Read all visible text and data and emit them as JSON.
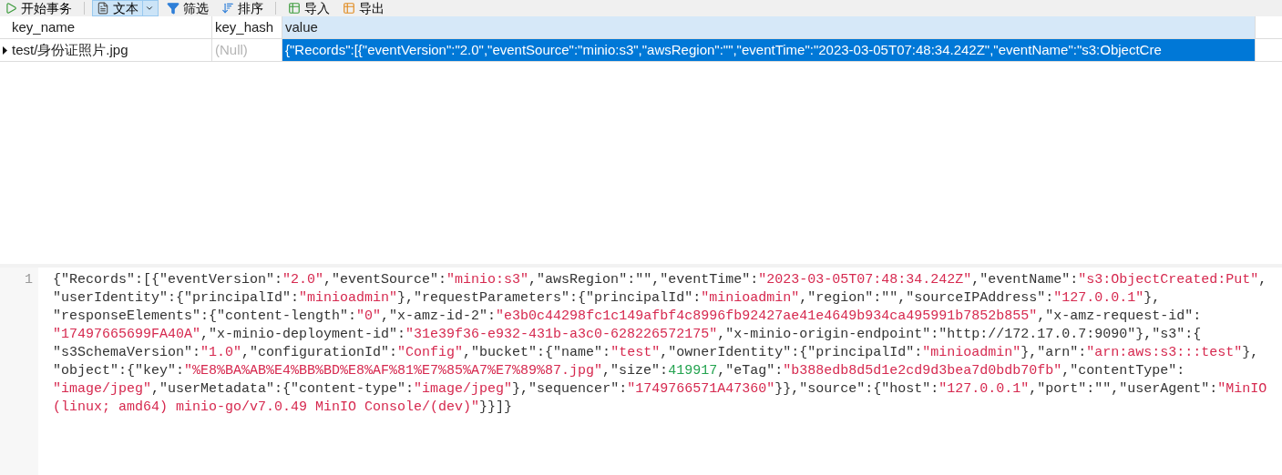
{
  "toolbar": [
    {
      "kind": "transaction",
      "label": "开始事务",
      "selected": false,
      "dropdown": false
    },
    {
      "kind": "text",
      "label": "文本",
      "selected": true,
      "dropdown": true
    },
    {
      "kind": "filter",
      "label": "筛选",
      "selected": false,
      "dropdown": false
    },
    {
      "kind": "sort",
      "label": "排序",
      "selected": false,
      "dropdown": false
    },
    {
      "kind": "import",
      "label": "导入",
      "selected": false,
      "dropdown": false
    },
    {
      "kind": "export",
      "label": "导出",
      "selected": false,
      "dropdown": false
    }
  ],
  "grid": {
    "columns": [
      "key_name",
      "key_hash",
      "value"
    ],
    "rows": [
      {
        "current": true,
        "cells": [
          {
            "kind": "text",
            "text": "test/身份证照片.jpg",
            "selected": false
          },
          {
            "kind": "null",
            "text": "(Null)",
            "selected": false
          },
          {
            "kind": "text",
            "text": "{\"Records\":[{\"eventVersion\":\"2.0\",\"eventSource\":\"minio:s3\",\"awsRegion\":\"\",\"eventTime\":\"2023-03-05T07:48:34.242Z\",\"eventName\":\"s3:ObjectCre",
            "selected": true
          }
        ]
      }
    ]
  },
  "editor": {
    "line_number": "1",
    "rows": [
      {
        "segments": [
          {
            "kind": "plain",
            "text": "{\"Records\":[{\"eventVersion\":"
          },
          {
            "kind": "string",
            "text": "\"2.0\""
          },
          {
            "kind": "plain",
            "text": ",\"eventSource\":"
          },
          {
            "kind": "string",
            "text": "\"minio:s3\""
          },
          {
            "kind": "plain",
            "text": ",\"awsRegion\":\"\",\"eventTime\":"
          },
          {
            "kind": "string",
            "text": "\"2023-03-05T07:48:34.242Z\""
          },
          {
            "kind": "plain",
            "text": ",\"eventName\":"
          },
          {
            "kind": "string",
            "text": "\"s3:ObjectCreated:Put\""
          },
          {
            "kind": "plain",
            "text": ","
          }
        ]
      },
      {
        "segments": [
          {
            "kind": "plain",
            "text": "\"userIdentity\":{\"principalId\":"
          },
          {
            "kind": "string",
            "text": "\"minioadmin\""
          },
          {
            "kind": "plain",
            "text": "},\"requestParameters\":{\"principalId\":"
          },
          {
            "kind": "string",
            "text": "\"minioadmin\""
          },
          {
            "kind": "plain",
            "text": ",\"region\":\"\",\"sourceIPAddress\":"
          },
          {
            "kind": "string",
            "text": "\"127.0.0.1\""
          },
          {
            "kind": "plain",
            "text": "},"
          }
        ]
      },
      {
        "segments": [
          {
            "kind": "plain",
            "text": "\"responseElements\":{\"content-length\":"
          },
          {
            "kind": "string",
            "text": "\"0\""
          },
          {
            "kind": "plain",
            "text": ",\"x-amz-id-2\":"
          },
          {
            "kind": "string",
            "text": "\"e3b0c44298fc1c149afbf4c8996fb92427ae41e4649b934ca495991b7852b855\""
          },
          {
            "kind": "plain",
            "text": ",\"x-amz-request-id\":"
          }
        ]
      },
      {
        "segments": [
          {
            "kind": "string",
            "text": "\"17497665699FA40A\""
          },
          {
            "kind": "plain",
            "text": ",\"x-minio-deployment-id\":"
          },
          {
            "kind": "string",
            "text": "\"31e39f36-e932-431b-a3c0-628226572175\""
          },
          {
            "kind": "plain",
            "text": ",\"x-minio-origin-endpoint\":\"http://172.17.0.7:9090\"},\"s3\":{"
          }
        ]
      },
      {
        "segments": [
          {
            "kind": "plain",
            "text": "\"s3SchemaVersion\":"
          },
          {
            "kind": "string",
            "text": "\"1.0\""
          },
          {
            "kind": "plain",
            "text": ",\"configurationId\":"
          },
          {
            "kind": "string",
            "text": "\"Config\""
          },
          {
            "kind": "plain",
            "text": ",\"bucket\":{\"name\":"
          },
          {
            "kind": "string",
            "text": "\"test\""
          },
          {
            "kind": "plain",
            "text": ",\"ownerIdentity\":{\"principalId\":"
          },
          {
            "kind": "string",
            "text": "\"minioadmin\""
          },
          {
            "kind": "plain",
            "text": "},\"arn\":"
          },
          {
            "kind": "string",
            "text": "\"arn:aws:s3:::test\""
          },
          {
            "kind": "plain",
            "text": "},"
          }
        ]
      },
      {
        "segments": [
          {
            "kind": "plain",
            "text": "\"object\":{\"key\":"
          },
          {
            "kind": "string",
            "text": "\"%E8%BA%AB%E4%BB%BD%E8%AF%81%E7%85%A7%E7%89%87.jpg\""
          },
          {
            "kind": "plain",
            "text": ",\"size\":"
          },
          {
            "kind": "number",
            "text": "419917"
          },
          {
            "kind": "plain",
            "text": ",\"eTag\":"
          },
          {
            "kind": "string",
            "text": "\"b388edb8d5d1e2cd9d3bea7d0bdb70fb\""
          },
          {
            "kind": "plain",
            "text": ",\"contentType\":"
          }
        ]
      },
      {
        "segments": [
          {
            "kind": "string",
            "text": "\"image/jpeg\""
          },
          {
            "kind": "plain",
            "text": ",\"userMetadata\":{\"content-type\":"
          },
          {
            "kind": "string",
            "text": "\"image/jpeg\""
          },
          {
            "kind": "plain",
            "text": "},\"sequencer\":"
          },
          {
            "kind": "string",
            "text": "\"1749766571A47360\""
          },
          {
            "kind": "plain",
            "text": "}},\"source\":{\"host\":"
          },
          {
            "kind": "string",
            "text": "\"127.0.0.1\""
          },
          {
            "kind": "plain",
            "text": ",\"port\":\"\",\"userAgent\":"
          },
          {
            "kind": "string",
            "text": "\"MinIO"
          }
        ]
      },
      {
        "segments": [
          {
            "kind": "string",
            "text": "(linux; amd64) minio-go/v7.0.49 MinIO Console/(dev)\""
          },
          {
            "kind": "plain",
            "text": "}}]}"
          }
        ]
      }
    ]
  }
}
